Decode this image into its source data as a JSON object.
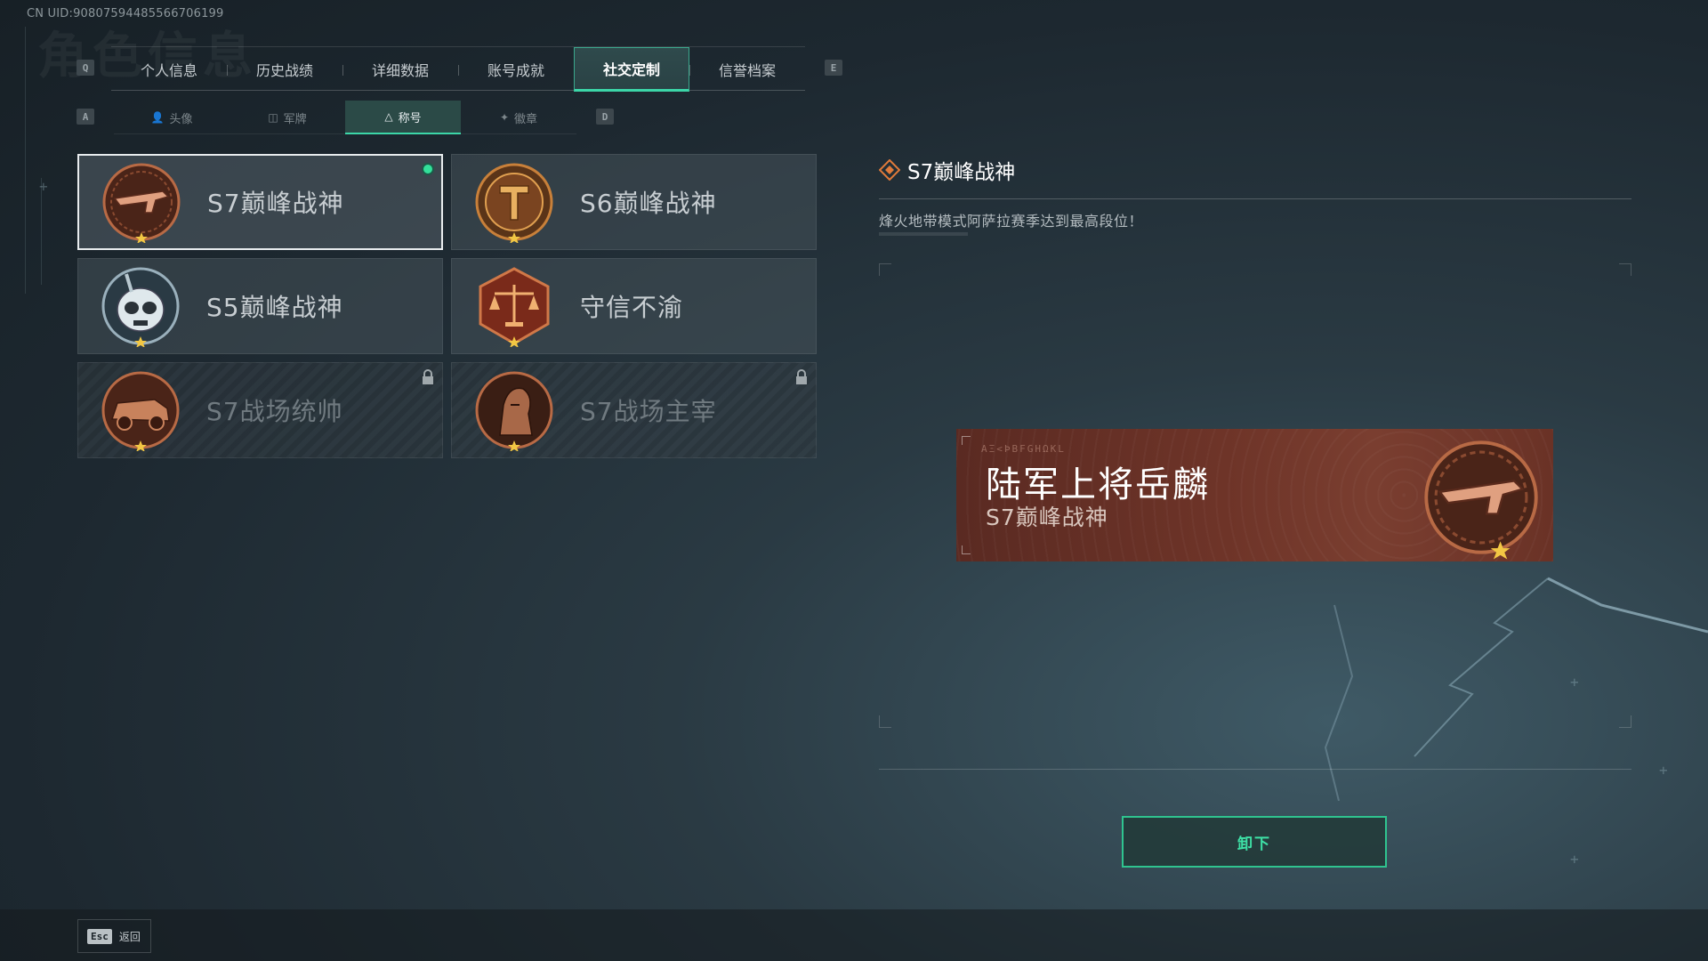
{
  "uid_text": "CN UID:90807594485566706199",
  "page_watermark": "角色信息",
  "main_tabs": {
    "prev_key": "Q",
    "next_key": "E",
    "items": [
      {
        "label": "个人信息",
        "active": false
      },
      {
        "label": "历史战绩",
        "active": false
      },
      {
        "label": "详细数据",
        "active": false
      },
      {
        "label": "账号成就",
        "active": false
      },
      {
        "label": "社交定制",
        "active": true
      },
      {
        "label": "信誉档案",
        "active": false
      }
    ]
  },
  "sub_tabs": {
    "prev_key": "A",
    "next_key": "D",
    "items": [
      {
        "label": "头像",
        "icon": "person-icon",
        "active": false
      },
      {
        "label": "军牌",
        "icon": "dogtag-icon",
        "active": false
      },
      {
        "label": "称号",
        "icon": "triangle-icon",
        "active": true
      },
      {
        "label": "徽章",
        "icon": "wings-icon",
        "active": false
      }
    ]
  },
  "titles": [
    {
      "label": "S7巅峰战神",
      "medal": "rifle-medal-icon",
      "selected": true,
      "equipped": true,
      "locked": false
    },
    {
      "label": "S6巅峰战神",
      "medal": "t-emblem-medal-icon",
      "selected": false,
      "equipped": false,
      "locked": false
    },
    {
      "label": "S5巅峰战神",
      "medal": "skull-mask-medal-icon",
      "selected": false,
      "equipped": false,
      "locked": false
    },
    {
      "label": "守信不渝",
      "medal": "scales-medal-icon",
      "selected": false,
      "equipped": false,
      "locked": false
    },
    {
      "label": "S7战场统帅",
      "medal": "vehicle-medal-icon",
      "selected": false,
      "equipped": false,
      "locked": true
    },
    {
      "label": "S7战场主宰",
      "medal": "warrior-medal-icon",
      "selected": false,
      "equipped": false,
      "locked": true
    }
  ],
  "detail": {
    "title": "S7巅峰战神",
    "description": "烽火地带模式阿萨拉赛季达到最高段位！"
  },
  "nameplate": {
    "code": "ΑΞ<ÞBFGHΩKL",
    "player_name": "陆军上将岳麟",
    "title": "S7巅峰战神"
  },
  "action_button": "卸下",
  "footer": {
    "esc_key": "Esc",
    "back_label": "返回"
  },
  "colors": {
    "accent_green": "#3cd6a8",
    "equipped_dot": "#33e09a",
    "nameplate_bg": "#6e3428",
    "medal_bronze": "#b86a45"
  }
}
